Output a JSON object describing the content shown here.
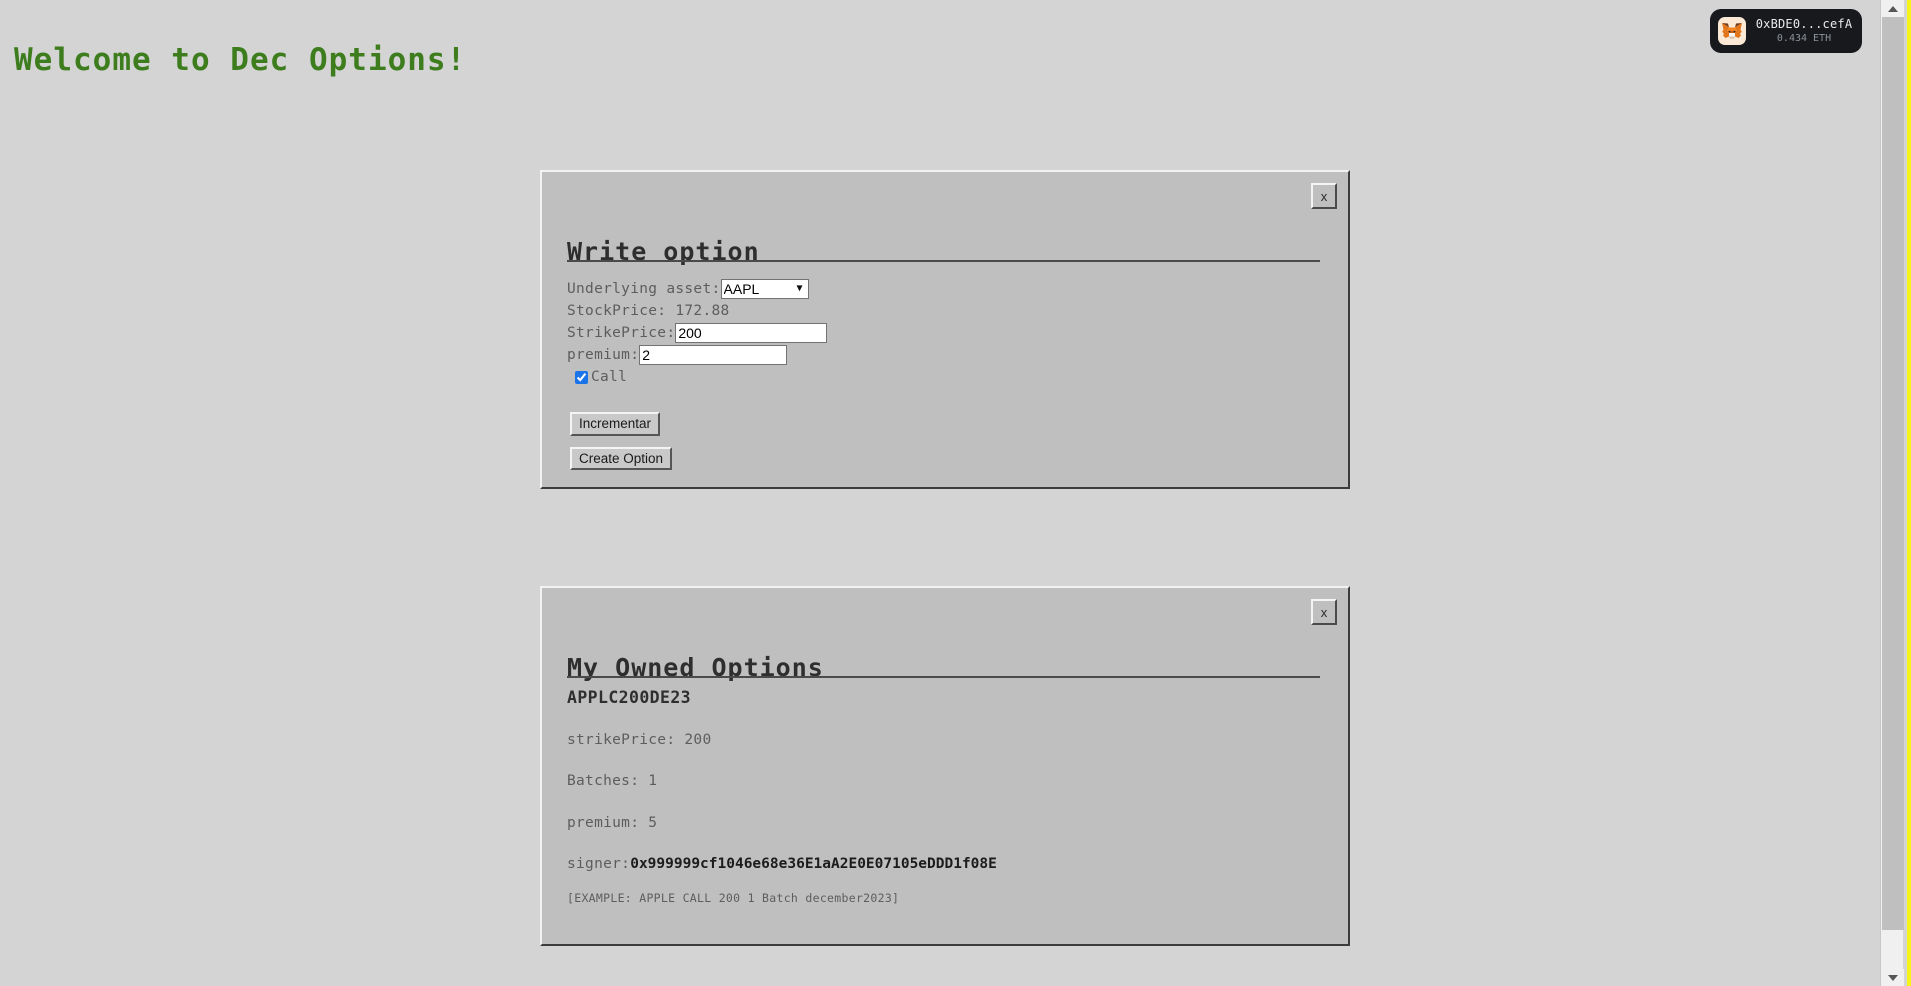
{
  "page": {
    "title": "Welcome to Dec Options!",
    "title_color": "#3d7d1e",
    "background_color": "#d4d4d4",
    "panel_color": "#bfbfbf",
    "accent_border_color": "#f5f518"
  },
  "wallet": {
    "icon": "metamask-fox-icon",
    "address": "0xBDE0...cefA",
    "balance": "0.434 ETH"
  },
  "write_option": {
    "heading": "Write option",
    "close_label": "x",
    "underlying_label": "Underlying asset:",
    "underlying_value": "AAPL",
    "underlying_options": [
      "AAPL"
    ],
    "stock_price_text": "StockPrice: 172.88",
    "strike_label": "StrikePrice:",
    "strike_value": "200",
    "premium_label": "premium:",
    "premium_value": "2",
    "call_label": "Call",
    "call_checked": true,
    "increment_label": "Incrementar",
    "create_label": "Create Option"
  },
  "owned_options": {
    "heading": "My Owned Options",
    "close_label": "x",
    "item_title": "APPLC200DE23",
    "strike_price": "strikePrice: 200",
    "batches": "Batches: 1",
    "premium": "premium: 5",
    "signer_label": "signer:",
    "signer_value": "0x999999cf1046e68e36E1aA2E0E07105eDDD1f08E",
    "example_note": "[EXAMPLE: APPLE CALL 200 1 Batch december2023]"
  },
  "scrollbar": {
    "up_arrow": "scroll-up-arrow",
    "down_arrow": "scroll-down-arrow"
  }
}
